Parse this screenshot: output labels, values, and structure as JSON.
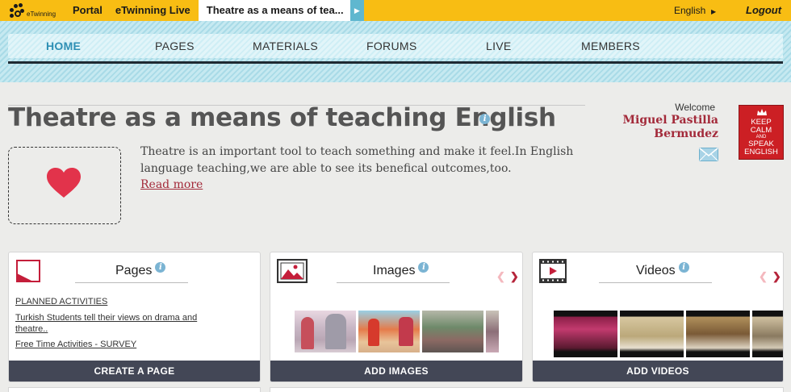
{
  "topbar": {
    "logo_text": "eTwinning",
    "links": [
      {
        "label": "Portal"
      },
      {
        "label": "eTwinning Live"
      }
    ],
    "active_tab": "Theatre as a means of tea...",
    "language": "English",
    "logout": "Logout"
  },
  "nav": {
    "items": [
      {
        "label": "HOME",
        "active": true
      },
      {
        "label": "PAGES"
      },
      {
        "label": "MATERIALS"
      },
      {
        "label": "FORUMS"
      },
      {
        "label": "LIVE"
      },
      {
        "label": "MEMBERS"
      }
    ]
  },
  "project": {
    "title": "Theatre as a means of teaching English",
    "description": "Theatre is an important tool to teach something and make it feel.In English language teaching,we are able to see its benefical outcomes,too.",
    "read_more": "Read more"
  },
  "user": {
    "welcome": "Welcome",
    "name_line1": "Miguel Pastilla",
    "name_line2": "Bermudez",
    "avatar_text": {
      "l1": "KEEP",
      "l2": "CALM",
      "l3": "AND",
      "l4": "SPEAK",
      "l5": "ENGLISH"
    }
  },
  "cards": {
    "pages": {
      "title": "Pages",
      "links": [
        "PLANNED ACTIVITIES",
        "Turkish Students tell their views on drama and theatre..",
        "Free Time Activities - SURVEY"
      ],
      "button": "CREATE A PAGE"
    },
    "images": {
      "title": "Images",
      "button": "ADD IMAGES"
    },
    "videos": {
      "title": "Videos",
      "button": "ADD VIDEOS"
    }
  },
  "colors": {
    "topbar": "#f8bd13",
    "accent_blue": "#2e8fb4",
    "accent_red": "#a32a3a",
    "button_dark": "#434756"
  }
}
